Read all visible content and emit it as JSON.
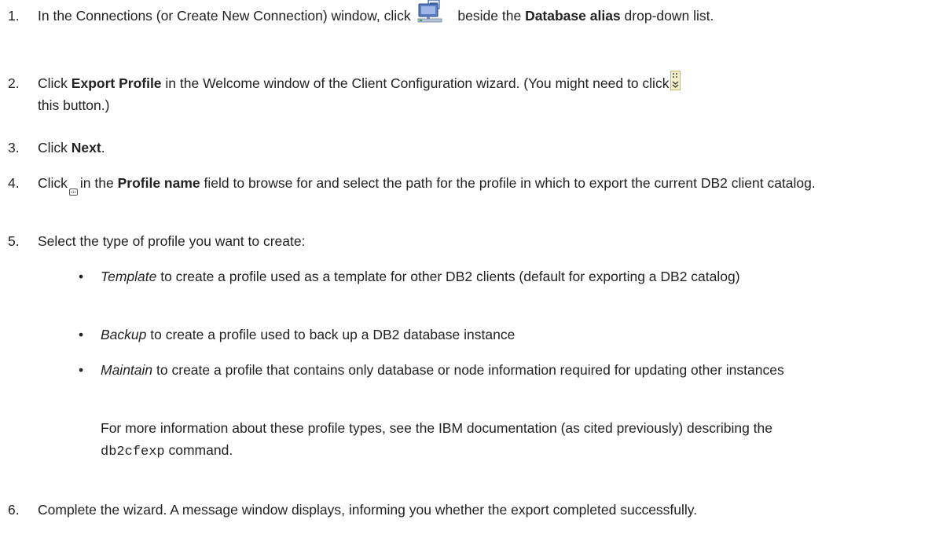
{
  "steps": [
    {
      "num": "1.",
      "t1": "In the Connections (or Create New Connection) window, click",
      "t2": "beside the",
      "bold": "Database alias",
      "t3": "drop-down  list.",
      "icon": "connection-wizard-icon"
    },
    {
      "num": "2.",
      "t1": "Click",
      "bold": "Export Profile",
      "t2": "in the Welcome window of the Client Configuration wizard. (You might need to click",
      "t3": "this button.)",
      "icon": "chevron-expand-icon"
    },
    {
      "num": "3.",
      "t1": "Click",
      "bold": "Next",
      "t2": "."
    },
    {
      "num": "4.",
      "t1": "Click",
      "t2": "in the",
      "bold": "Profile name",
      "t3": "field to browse for and select the path for the profile in which to export the current DB2 client catalog.",
      "icon": "browse-icon"
    },
    {
      "num": "5.",
      "t1": "Select the type of profile you want to create:",
      "bullets": [
        {
          "italic": "Template",
          "text": "to create a profile used as a template for other DB2 clients (default for exporting a DB2 catalog)"
        },
        {
          "italic": "Backup",
          "text": "to create a profile used to back up a DB2 database instance"
        },
        {
          "italic": "Maintain",
          "text": "to create a profile that contains only database or node information required for updating other instances"
        }
      ],
      "note1": "For more information about these profile types, see the IBM documentation (as cited previously) describing the",
      "code": "db2cfexp",
      "note2": "command."
    },
    {
      "num": "6.",
      "t1": "Complete the wizard. A message window displays, informing you whether the export completed successfully."
    }
  ],
  "bullet_char": "•"
}
